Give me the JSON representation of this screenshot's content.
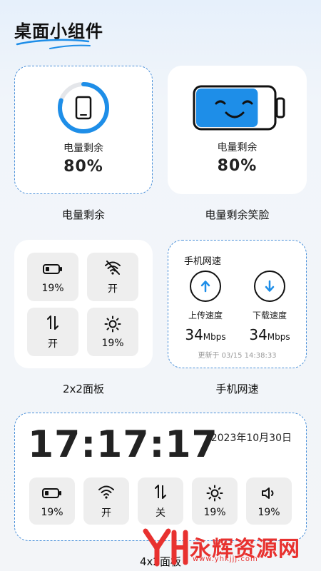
{
  "page": {
    "title": "桌面小组件"
  },
  "battery_widget": {
    "label": "电量剩余",
    "value": "80%",
    "caption": "电量剩余",
    "level": 0.8
  },
  "battery_smile_widget": {
    "label": "电量剩余",
    "value": "80%",
    "caption": "电量剩余笑脸",
    "level": 0.8
  },
  "panel_2x2": {
    "caption": "2x2面板",
    "tiles": [
      {
        "icon": "battery-icon",
        "text": "19%"
      },
      {
        "icon": "wifi-off-icon",
        "text": "开"
      },
      {
        "icon": "data-transfer-icon",
        "text": "开"
      },
      {
        "icon": "brightness-icon",
        "text": "19%"
      }
    ]
  },
  "net_speed": {
    "title": "手机网速",
    "caption": "手机网速",
    "upload_label": "上传速度",
    "download_label": "下载速度",
    "upload_value": "34",
    "download_value": "34",
    "unit": "Mbps",
    "updated": "更新于 03/15 14:38:33"
  },
  "panel_4x2": {
    "time": "17:17:17",
    "date": "2023年10月30日",
    "caption": "4x2面板",
    "tiles": [
      {
        "icon": "battery-icon",
        "text": "19%"
      },
      {
        "icon": "wifi-icon",
        "text": "开"
      },
      {
        "icon": "data-transfer-icon",
        "text": "关"
      },
      {
        "icon": "brightness-icon",
        "text": "19%"
      },
      {
        "icon": "volume-icon",
        "text": "19%"
      }
    ]
  },
  "watermark": {
    "text": "永辉资源网",
    "url": "www.yhkjjj.com"
  },
  "colors": {
    "accent": "#1e8ee8",
    "dashed": "#4a90d9",
    "watermark": "#e8312f"
  }
}
